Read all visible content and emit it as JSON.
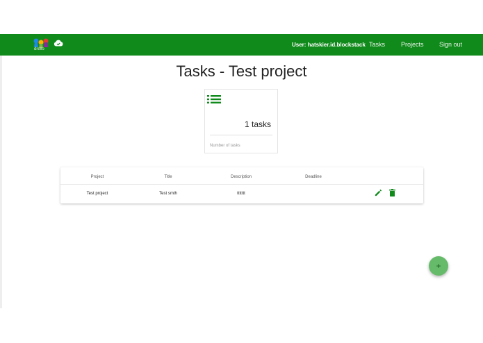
{
  "navbar": {
    "brand_text": "drello",
    "user_label": "User: hatskier.id.blockstack",
    "links": [
      "Tasks",
      "Projects",
      "Sign out"
    ]
  },
  "page": {
    "title": "Tasks - Test project"
  },
  "stat_card": {
    "value": "1 tasks",
    "label": "Number of tasks",
    "icon": "list-icon"
  },
  "table": {
    "headers": [
      "Project",
      "Title",
      "Description",
      "Deadline"
    ],
    "rows": [
      {
        "project": "Test project",
        "title": "Test smth",
        "description": "ttttttt",
        "deadline": ""
      }
    ]
  },
  "fab": {
    "label": "+"
  },
  "colors": {
    "primary": "#118a1c",
    "accent": "#66bb6a"
  }
}
